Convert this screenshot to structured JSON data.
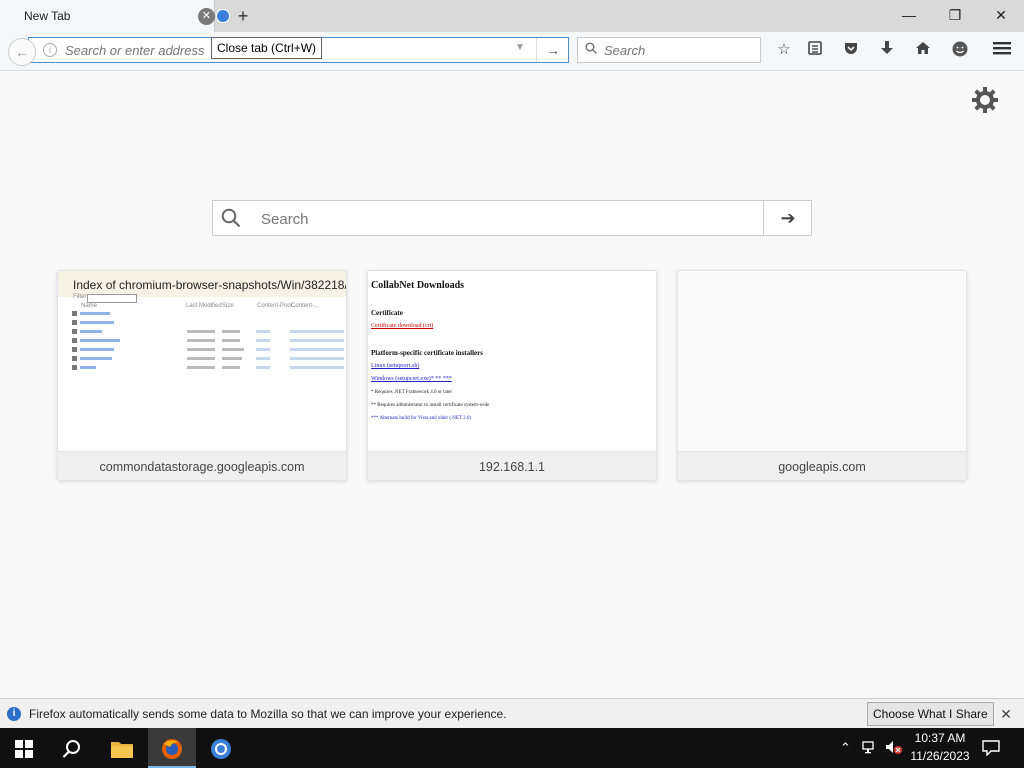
{
  "tabs": [
    {
      "title": "New Tab"
    }
  ],
  "tooltip": "Close tab (Ctrl+W)",
  "urlbar": {
    "placeholder": "Search or enter address"
  },
  "searchbar": {
    "placeholder": "Search"
  },
  "newtab_search": {
    "placeholder": "Search"
  },
  "tiles": [
    {
      "label": "commondatastorage.googleapis.com",
      "thumb_title": "Index of chromium-browser-snapshots/Win/382218/",
      "thumb_filter": "Filter:",
      "thumb_headers": [
        "Name",
        "Last Modified",
        "Size",
        "Content-Pool...",
        "Content-..."
      ]
    },
    {
      "label": "192.168.1.1",
      "thumb_title": "CollabNet Downloads",
      "thumb_lines": [
        "Certificate",
        "Certificate download (crt)",
        "Platform-specific certificate installers",
        "Linux (setupcert.sh)",
        "Windows (setupcert.exe)* ** ***",
        "* Requires .NET Framework 4.0 or later",
        "** Requires administrator to install certificate system-wide",
        "*** Alternate build for Vista and older (.NET 2.0)"
      ]
    },
    {
      "label": "googleapis.com"
    }
  ],
  "notification": {
    "text": "Firefox automatically sends some data to Mozilla so that we can improve your experience.",
    "button": "Choose What I Share"
  },
  "taskbar": {
    "time": "10:37 AM",
    "date": "11/26/2023"
  },
  "colors": {
    "accent": "#4a90d9",
    "taskbar": "#101010",
    "page_bg": "#f9f9fa"
  }
}
